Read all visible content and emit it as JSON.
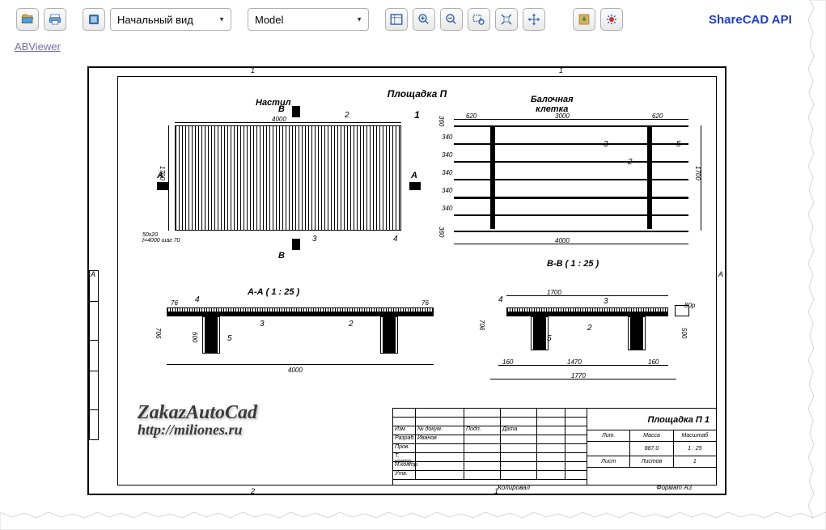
{
  "toolbar": {
    "open_tip": "Открыть",
    "print_tip": "Печать",
    "fullscreen_tip": "На весь экран",
    "view_select": "Начальный вид",
    "layout_select": "Model",
    "fit_tip": "По размеру окна",
    "zoom_in_tip": "Увеличить",
    "zoom_out_tip": "Уменьшить",
    "zoom_window_tip": "Рамка",
    "extents_tip": "Показать всё",
    "pan_tip": "Панорамирование",
    "save_tip": "Сохранить",
    "settings_tip": "Настройки"
  },
  "api_link": "ShareCAD API",
  "viewer_link": "ABViewer",
  "drawing": {
    "main_title": "Площадка П",
    "main_title_num": "1",
    "view1_title": "Настил",
    "view2_title": "Балочная\nклетка",
    "section_aa": "А-А ( 1 : 25 )",
    "section_bb": "В-В ( 1 : 25 )",
    "mark_a": "А",
    "mark_b": "В",
    "dims": {
      "d4000": "4000",
      "d1700": "1700",
      "d620_l": "620",
      "d3000": "3000",
      "d620_r": "620",
      "d340_1": "340",
      "d340_2": "340",
      "d340_3": "340",
      "d340_4": "340",
      "d340_5": "340",
      "d360_t": "360",
      "d360_b": "360",
      "d706_a": "706",
      "d600": "600",
      "d76_l": "76",
      "d76_r": "76",
      "d1470": "1470",
      "d1770": "1770",
      "d706_b": "706",
      "d160_l": "160",
      "d160_r": "160",
      "d80p": "80р",
      "d500": "500",
      "note": "50x20\nt=4000 шаг 70"
    },
    "leaders": {
      "n2": "2",
      "n3": "3",
      "n4": "4",
      "n5": "5"
    }
  },
  "title_block": {
    "main": "Площадка П 1",
    "rows": [
      "Изм",
      "Разраб.",
      "Пров.",
      "Т. контр.",
      "Н.контр.",
      "Утв."
    ],
    "headers": [
      "№ докум.",
      "Подп.",
      "Дата"
    ],
    "name": "Иванов",
    "fields": {
      "lit": "Лит.",
      "mass": "Масса",
      "scale": "Масштаб",
      "mass_val": "887,0",
      "scale_val": "1 : 25",
      "sheet": "Лист",
      "sheets": "Листов",
      "sheets_val": "1"
    },
    "bottom": {
      "copied": "Копировал",
      "format": "Формат A3"
    }
  },
  "edges": {
    "top_l": "1",
    "top_r": "1",
    "bot_l": "2",
    "bot_r": "1",
    "left": "А",
    "right": "А"
  },
  "watermark": {
    "l1": "ZakazAutoCad",
    "l2": "http://miliones.ru"
  }
}
